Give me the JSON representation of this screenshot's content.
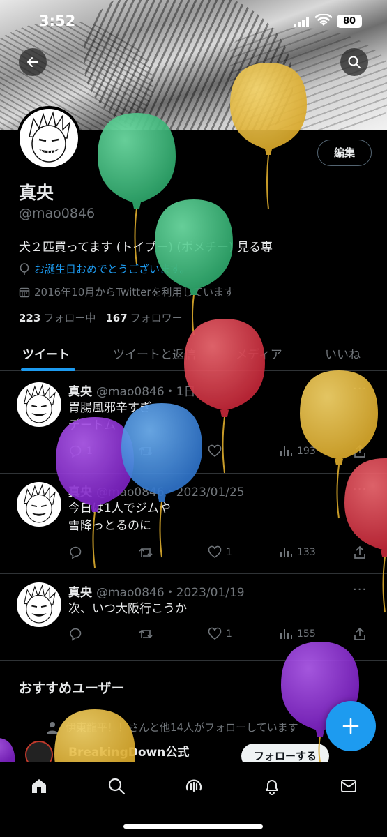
{
  "status_bar": {
    "time": "3:52",
    "battery": "80"
  },
  "profile": {
    "edit_label": "編集",
    "name": "真央",
    "handle": "@mao0846",
    "bio": "犬２匹買ってます (トイプー) (ポメチー) 見る専",
    "birthday_text": "お誕生日おめでとうございます。",
    "joined_text": "2016年10月からTwitterを利用しています",
    "following_count": "223",
    "following_label": "フォロー中",
    "followers_count": "167",
    "followers_label": "フォロワー"
  },
  "tabs": [
    {
      "label": "ツイート"
    },
    {
      "label": "ツイートと返信"
    },
    {
      "label": "メディア"
    },
    {
      "label": "いいね"
    }
  ],
  "tweets": [
    {
      "name": "真央",
      "meta": "@mao0846・1日",
      "body": "胃腸風邪辛すぎ\nデートム",
      "reply": "1",
      "retweet": "",
      "like": "",
      "views": "193"
    },
    {
      "name": "真央",
      "meta": "@mao0846・2023/01/25",
      "body": "今日は1人でジムや\n雪降っとるのに",
      "reply": "",
      "retweet": "",
      "like": "1",
      "views": "133"
    },
    {
      "name": "真央",
      "meta": "@mao0846・2023/01/19",
      "body": "次、いつ大阪行こうか",
      "reply": "",
      "retweet": "",
      "like": "1",
      "views": "155"
    }
  ],
  "recommended": {
    "title": "おすすめユーザー",
    "context": "伊東龍平！！さんと他14人がフォローしています",
    "name": "BreakingDown公式",
    "follow_label": "フォローする"
  },
  "icons": {
    "back": "arrow-left-icon",
    "search": "search-icon",
    "balloon": "birthday-balloon-icon",
    "home": "home-icon",
    "explore": "search-icon",
    "spaces": "spaces-icon",
    "notifications": "bell-icon",
    "messages": "envelope-icon",
    "compose": "plus-icon"
  },
  "colors": {
    "accent": "#1d9bf0",
    "background": "#000000",
    "secondary_text": "#71767b"
  }
}
